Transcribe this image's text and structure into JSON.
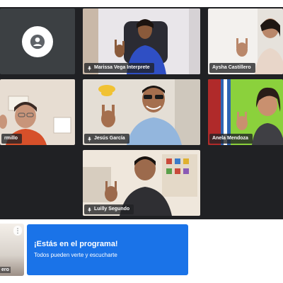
{
  "participants": [
    {
      "id": "p1",
      "name": "",
      "label_visible": false,
      "avatar": "person-icon"
    },
    {
      "id": "p2",
      "name": "Marissa Vega Interprete"
    },
    {
      "id": "p3",
      "name": "Aysha Castillero"
    },
    {
      "id": "p4",
      "name": "rmillo"
    },
    {
      "id": "p5",
      "name": "Jesús García"
    },
    {
      "id": "p6",
      "name": "Anela Mendoza"
    },
    {
      "id": "p7",
      "name": "Luilly Segundo"
    }
  ],
  "self_view": {
    "name": "ero",
    "menu_glyph": "⋮"
  },
  "info_card": {
    "title": "¡Estás en el programa!",
    "subtitle": "Todos pueden verte y escucharte"
  },
  "colors": {
    "grid_background": "#202124",
    "tile_background": "#3c4043",
    "accent": "#1a73e8",
    "text_light": "#ffffff"
  },
  "icons": [
    "person-icon",
    "mic-icon",
    "more-options-icon"
  ]
}
